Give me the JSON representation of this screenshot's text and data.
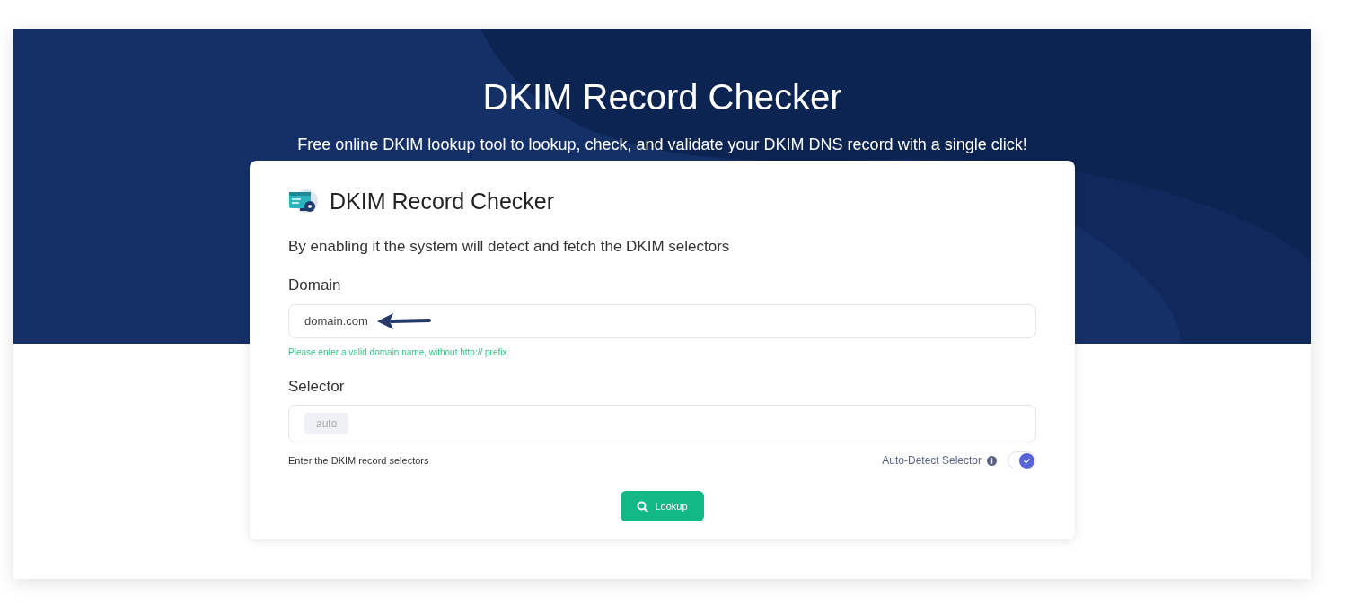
{
  "hero": {
    "title": "DKIM Record Checker",
    "subtitle": "Free online DKIM lookup tool to lookup, check, and validate your DKIM DNS record with a single click!"
  },
  "card": {
    "title": "DKIM Record Checker",
    "description": "By enabling it the system will detect and fetch the DKIM selectors",
    "domain": {
      "label": "Domain",
      "value": "domain.com",
      "hint": "Please enter a valid domain name, without http:// prefix"
    },
    "selector": {
      "label": "Selector",
      "tags": [
        "auto"
      ],
      "hint": "Enter the DKIM record selectors"
    },
    "auto_detect": {
      "label": "Auto-Detect Selector",
      "on": true
    },
    "button": "Lookup"
  }
}
